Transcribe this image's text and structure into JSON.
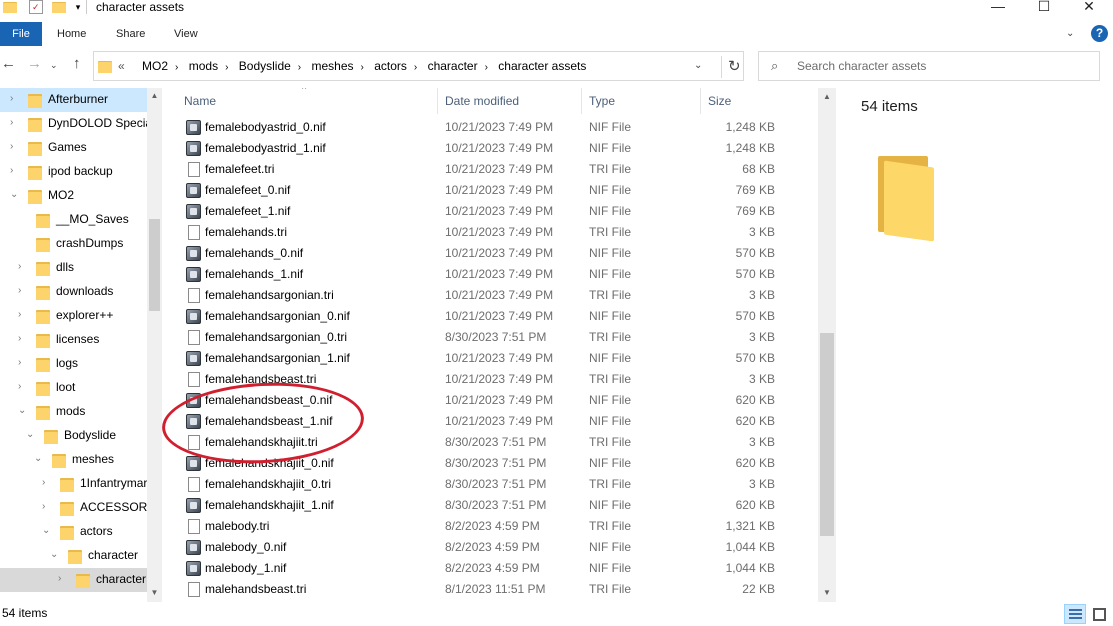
{
  "window": {
    "title": "character assets",
    "buttons": {
      "minimize": "—",
      "maximize": "☐",
      "close": "✕"
    }
  },
  "ribbon": {
    "file": "File",
    "tabs": [
      "Home",
      "Share",
      "View"
    ],
    "help": "?"
  },
  "address": {
    "prefix": "«",
    "crumbs": [
      "MO2",
      "mods",
      "Bodyslide",
      "meshes",
      "actors",
      "character",
      "character assets"
    ]
  },
  "search": {
    "placeholder": "Search character assets"
  },
  "tree": [
    {
      "label": "Afterburner",
      "level": 1,
      "expanded": false,
      "state": "selected"
    },
    {
      "label": "DynDOLOD Specia",
      "level": 1,
      "expanded": false,
      "state": ""
    },
    {
      "label": "Games",
      "level": 1,
      "expanded": false,
      "state": ""
    },
    {
      "label": "ipod backup",
      "level": 1,
      "expanded": false,
      "state": ""
    },
    {
      "label": "MO2",
      "level": 1,
      "expanded": true,
      "state": ""
    },
    {
      "label": "__MO_Saves",
      "level": 2,
      "expanded": null,
      "state": ""
    },
    {
      "label": "crashDumps",
      "level": 2,
      "expanded": null,
      "state": ""
    },
    {
      "label": "dlls",
      "level": 2,
      "expanded": false,
      "state": ""
    },
    {
      "label": "downloads",
      "level": 2,
      "expanded": false,
      "state": ""
    },
    {
      "label": "explorer++",
      "level": 2,
      "expanded": false,
      "state": ""
    },
    {
      "label": "licenses",
      "level": 2,
      "expanded": false,
      "state": ""
    },
    {
      "label": "logs",
      "level": 2,
      "expanded": false,
      "state": ""
    },
    {
      "label": "loot",
      "level": 2,
      "expanded": false,
      "state": ""
    },
    {
      "label": "mods",
      "level": 2,
      "expanded": true,
      "state": ""
    },
    {
      "label": "Bodyslide",
      "level": 3,
      "expanded": true,
      "state": ""
    },
    {
      "label": "meshes",
      "level": 4,
      "expanded": true,
      "state": ""
    },
    {
      "label": "1Infantrymar",
      "level": 5,
      "expanded": false,
      "state": ""
    },
    {
      "label": "ACCESSORIZ",
      "level": 5,
      "expanded": false,
      "state": ""
    },
    {
      "label": "actors",
      "level": 5,
      "expanded": true,
      "state": ""
    },
    {
      "label": "character",
      "level": 6,
      "expanded": true,
      "state": ""
    },
    {
      "label": "character",
      "level": 7,
      "expanded": false,
      "state": "sel-grey"
    }
  ],
  "columns": {
    "name": "Name",
    "date": "Date modified",
    "type": "Type",
    "size": "Size"
  },
  "files": [
    {
      "name": "femalebodyastrid_0.nif",
      "date": "10/21/2023 7:49 PM",
      "type": "NIF File",
      "size": "1,248 KB",
      "icon": "nif"
    },
    {
      "name": "femalebodyastrid_1.nif",
      "date": "10/21/2023 7:49 PM",
      "type": "NIF File",
      "size": "1,248 KB",
      "icon": "nif"
    },
    {
      "name": "femalefeet.tri",
      "date": "10/21/2023 7:49 PM",
      "type": "TRI File",
      "size": "68 KB",
      "icon": "tri"
    },
    {
      "name": "femalefeet_0.nif",
      "date": "10/21/2023 7:49 PM",
      "type": "NIF File",
      "size": "769 KB",
      "icon": "nif"
    },
    {
      "name": "femalefeet_1.nif",
      "date": "10/21/2023 7:49 PM",
      "type": "NIF File",
      "size": "769 KB",
      "icon": "nif"
    },
    {
      "name": "femalehands.tri",
      "date": "10/21/2023 7:49 PM",
      "type": "TRI File",
      "size": "3 KB",
      "icon": "tri"
    },
    {
      "name": "femalehands_0.nif",
      "date": "10/21/2023 7:49 PM",
      "type": "NIF File",
      "size": "570 KB",
      "icon": "nif"
    },
    {
      "name": "femalehands_1.nif",
      "date": "10/21/2023 7:49 PM",
      "type": "NIF File",
      "size": "570 KB",
      "icon": "nif"
    },
    {
      "name": "femalehandsargonian.tri",
      "date": "10/21/2023 7:49 PM",
      "type": "TRI File",
      "size": "3 KB",
      "icon": "tri"
    },
    {
      "name": "femalehandsargonian_0.nif",
      "date": "10/21/2023 7:49 PM",
      "type": "NIF File",
      "size": "570 KB",
      "icon": "nif"
    },
    {
      "name": "femalehandsargonian_0.tri",
      "date": "8/30/2023 7:51 PM",
      "type": "TRI File",
      "size": "3 KB",
      "icon": "tri"
    },
    {
      "name": "femalehandsargonian_1.nif",
      "date": "10/21/2023 7:49 PM",
      "type": "NIF File",
      "size": "570 KB",
      "icon": "nif"
    },
    {
      "name": "femalehandsbeast.tri",
      "date": "10/21/2023 7:49 PM",
      "type": "TRI File",
      "size": "3 KB",
      "icon": "tri"
    },
    {
      "name": "femalehandsbeast_0.nif",
      "date": "10/21/2023 7:49 PM",
      "type": "NIF File",
      "size": "620 KB",
      "icon": "nif"
    },
    {
      "name": "femalehandsbeast_1.nif",
      "date": "10/21/2023 7:49 PM",
      "type": "NIF File",
      "size": "620 KB",
      "icon": "nif"
    },
    {
      "name": "femalehandskhajiit.tri",
      "date": "8/30/2023 7:51 PM",
      "type": "TRI File",
      "size": "3 KB",
      "icon": "tri"
    },
    {
      "name": "femalehandskhajiit_0.nif",
      "date": "8/30/2023 7:51 PM",
      "type": "NIF File",
      "size": "620 KB",
      "icon": "nif"
    },
    {
      "name": "femalehandskhajiit_0.tri",
      "date": "8/30/2023 7:51 PM",
      "type": "TRI File",
      "size": "3 KB",
      "icon": "tri"
    },
    {
      "name": "femalehandskhajiit_1.nif",
      "date": "8/30/2023 7:51 PM",
      "type": "NIF File",
      "size": "620 KB",
      "icon": "nif"
    },
    {
      "name": "malebody.tri",
      "date": "8/2/2023 4:59 PM",
      "type": "TRI File",
      "size": "1,321 KB",
      "icon": "tri"
    },
    {
      "name": "malebody_0.nif",
      "date": "8/2/2023 4:59 PM",
      "type": "NIF File",
      "size": "1,044 KB",
      "icon": "nif"
    },
    {
      "name": "malebody_1.nif",
      "date": "8/2/2023 4:59 PM",
      "type": "NIF File",
      "size": "1,044 KB",
      "icon": "nif"
    },
    {
      "name": "malehandsbeast.tri",
      "date": "8/1/2023 11:51 PM",
      "type": "TRI File",
      "size": "22 KB",
      "icon": "tri"
    }
  ],
  "details": {
    "count": "54 items"
  },
  "status": {
    "count": "54 items"
  },
  "colors": {
    "accent": "#1a64b4",
    "selection": "#cce8ff",
    "annotation": "#d02030"
  }
}
